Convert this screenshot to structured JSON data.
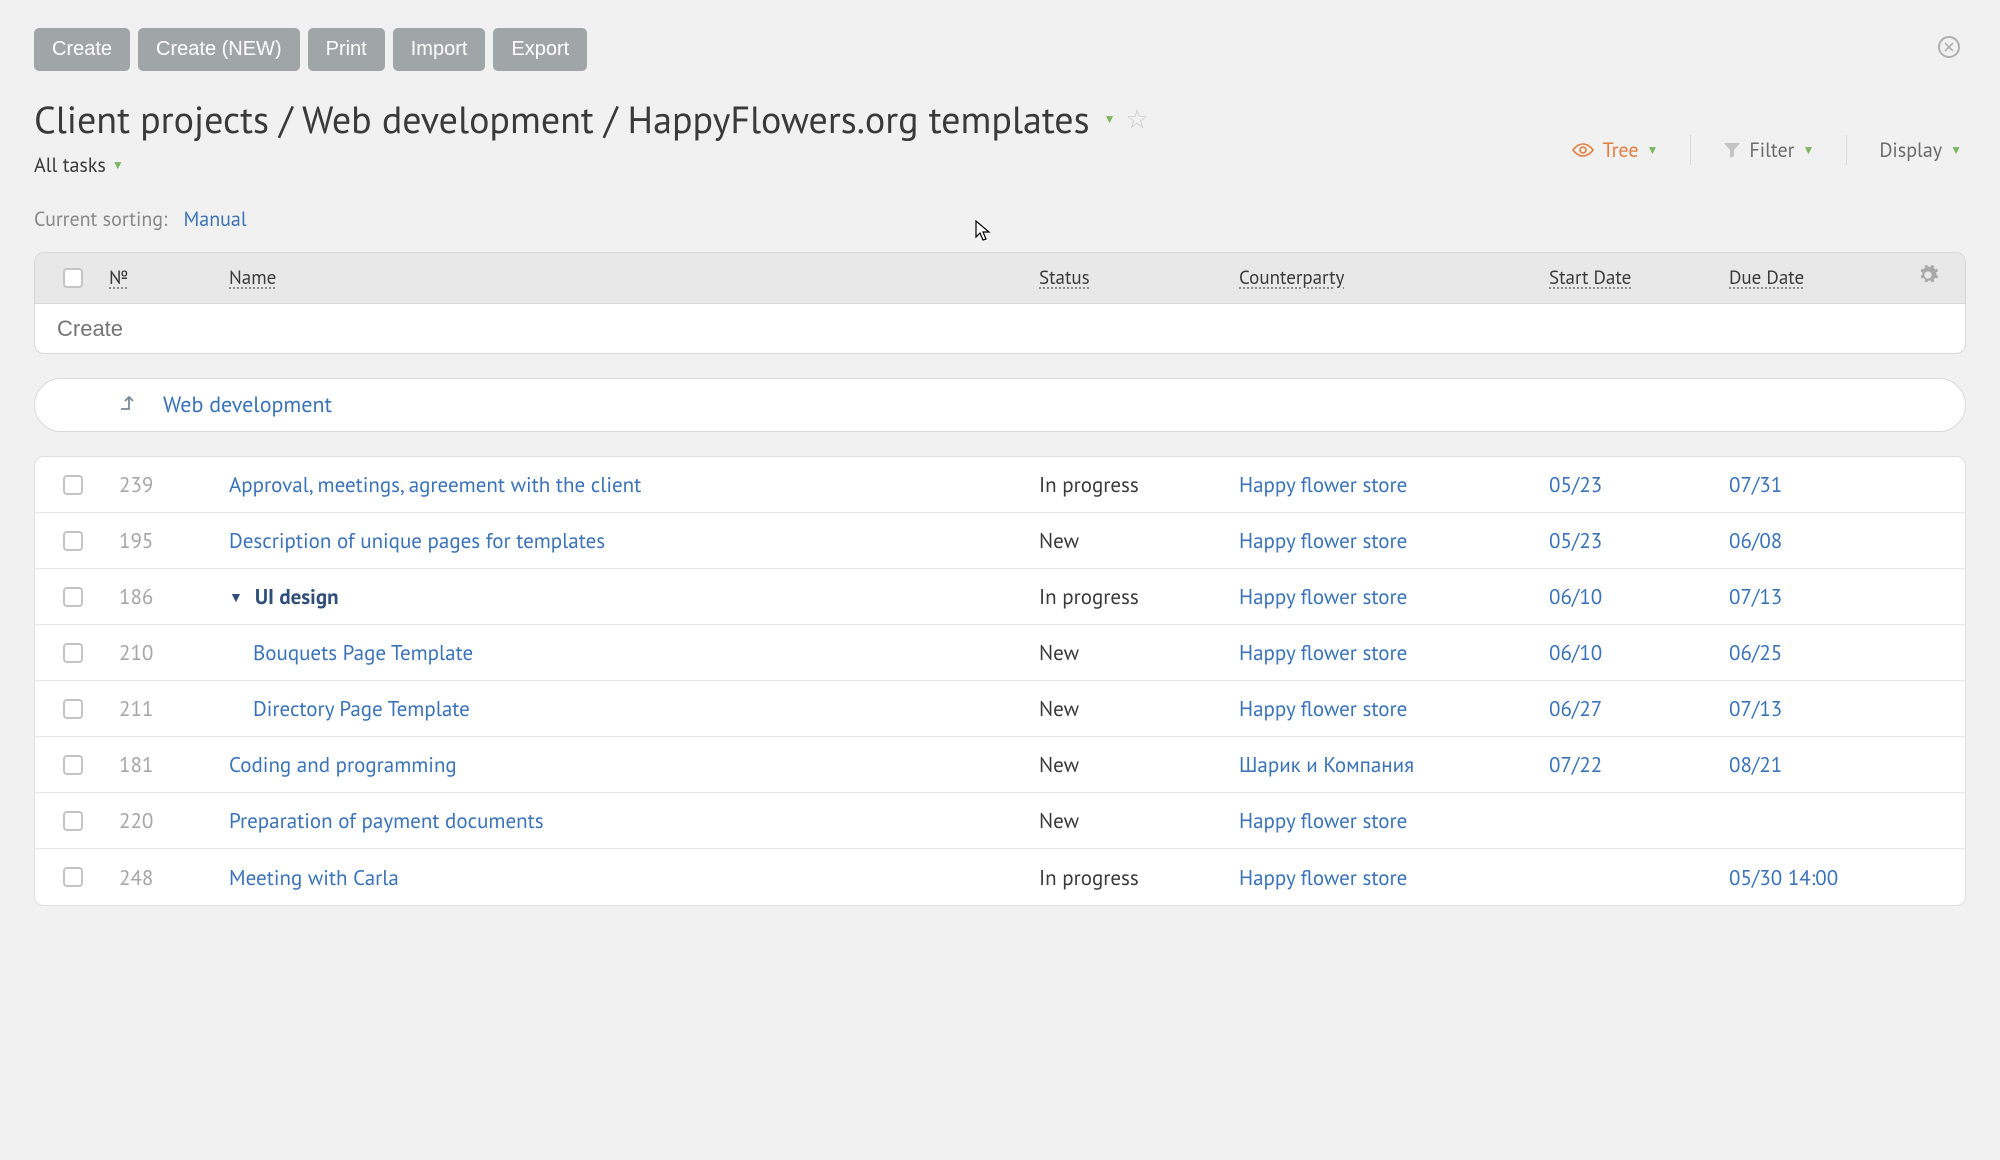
{
  "toolbar": {
    "create": "Create",
    "create_new": "Create (NEW)",
    "print": "Print",
    "import": "Import",
    "export": "Export"
  },
  "breadcrumb": {
    "full": "Client projects / Web development / HappyFlowers.org templates"
  },
  "filter_scope": "All tasks",
  "right_controls": {
    "tree": "Tree",
    "filter": "Filter",
    "display": "Display"
  },
  "sorting": {
    "label": "Current sorting:",
    "value": "Manual"
  },
  "columns": {
    "num": "№",
    "name": "Name",
    "status": "Status",
    "counterparty": "Counterparty",
    "start_date": "Start Date",
    "due_date": "Due Date"
  },
  "create_placeholder": "Create",
  "parent_link": "Web development",
  "rows": [
    {
      "num": "239",
      "name": "Approval, meetings, agreement with the client",
      "status": "In progress",
      "counterparty": "Happy flower store",
      "start": "05/23",
      "due": "07/31",
      "indent": 0,
      "bold": false,
      "expandable": false
    },
    {
      "num": "195",
      "name": "Description of unique pages for templates",
      "status": "New",
      "counterparty": "Happy flower store",
      "start": "05/23",
      "due": "06/08",
      "indent": 0,
      "bold": false,
      "expandable": false
    },
    {
      "num": "186",
      "name": "UI design",
      "status": "In progress",
      "counterparty": "Happy flower store",
      "start": "06/10",
      "due": "07/13",
      "indent": 0,
      "bold": true,
      "expandable": true
    },
    {
      "num": "210",
      "name": "Bouquets Page Template",
      "status": "New",
      "counterparty": "Happy flower store",
      "start": "06/10",
      "due": "06/25",
      "indent": 1,
      "bold": false,
      "expandable": false
    },
    {
      "num": "211",
      "name": "Directory Page Template",
      "status": "New",
      "counterparty": "Happy flower store",
      "start": "06/27",
      "due": "07/13",
      "indent": 1,
      "bold": false,
      "expandable": false
    },
    {
      "num": "181",
      "name": "Coding and programming",
      "status": "New",
      "counterparty": "Шарик и Компания",
      "start": "07/22",
      "due": "08/21",
      "indent": 0,
      "bold": false,
      "expandable": false
    },
    {
      "num": "220",
      "name": "Preparation of payment documents",
      "status": "New",
      "counterparty": "Happy flower store",
      "start": "",
      "due": "",
      "indent": 0,
      "bold": false,
      "expandable": false
    },
    {
      "num": "248",
      "name": "Meeting with Carla",
      "status": "In progress",
      "counterparty": "Happy flower store",
      "start": "",
      "due": "05/30 14:00",
      "indent": 0,
      "bold": false,
      "expandable": false
    }
  ]
}
